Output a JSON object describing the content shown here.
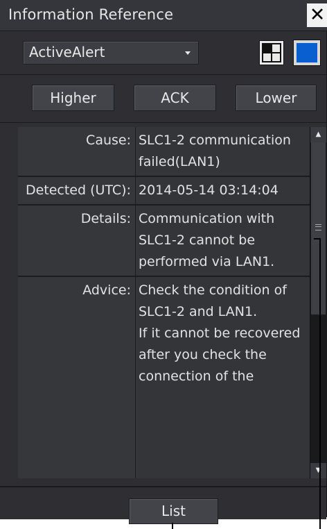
{
  "window": {
    "title": "Information Reference",
    "close_label": "✕"
  },
  "toolbar": {
    "dropdown_value": "ActiveAlert",
    "layout_icon": "window-layout-icon",
    "color_icon": "color-swatch-icon",
    "color_swatch": "#0a5fd0"
  },
  "nav": {
    "higher": "Higher",
    "ack": "ACK",
    "lower": "Lower"
  },
  "details": {
    "cause": {
      "label": "Cause:",
      "value": "SLC1-2 communication failed(LAN1)"
    },
    "detected": {
      "label": "Detected (UTC):",
      "value": "2014-05-14 03:14:04"
    },
    "details": {
      "label": "Details:",
      "value": "Communication with SLC1-2 cannot be performed via LAN1."
    },
    "advice": {
      "label": "Advice:",
      "value": "Check the condition of SLC1-2 and LAN1.\nIf it cannot be recovered after you check the connection of the"
    }
  },
  "scrollbar": {
    "up_icon": "scroll-up-arrow-icon",
    "down_icon": "scroll-down-arrow-icon",
    "position": 0.0
  },
  "footer": {
    "list_label": "List"
  }
}
